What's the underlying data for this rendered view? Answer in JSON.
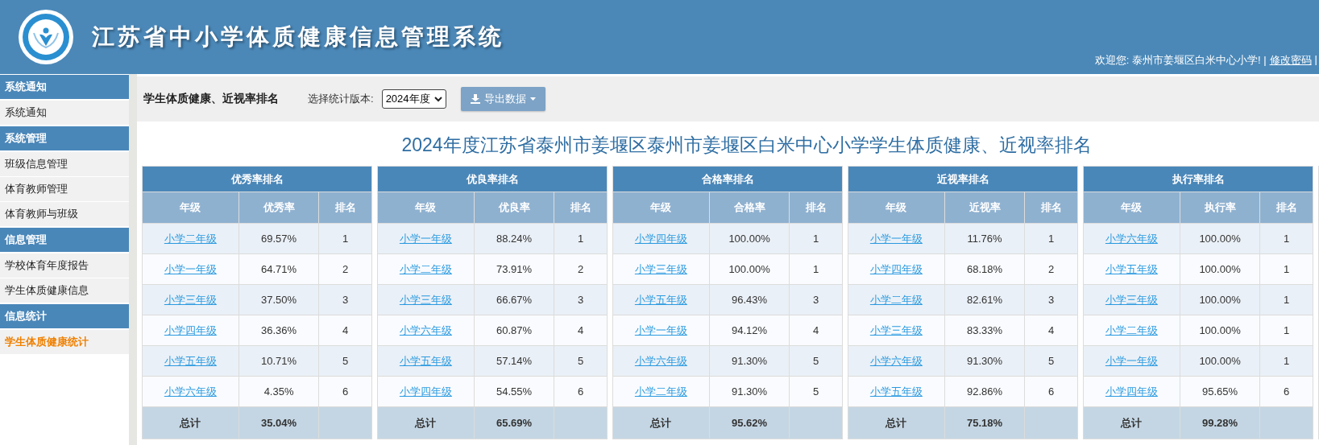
{
  "header": {
    "title": "江苏省中小学体质健康信息管理系统",
    "welcome": "欢迎您: 泰州市姜堰区白米中心小学! |",
    "links": [
      "修改密码"
    ],
    "trailing": "|"
  },
  "sidebar": {
    "sections": [
      {
        "title": "系统通知",
        "items": [
          {
            "label": "系统通知",
            "selected": false
          }
        ]
      },
      {
        "title": "系统管理",
        "items": [
          {
            "label": "班级信息管理",
            "selected": false
          },
          {
            "label": "体育教师管理",
            "selected": false
          },
          {
            "label": "体育教师与班级",
            "selected": false
          }
        ]
      },
      {
        "title": "信息管理",
        "items": [
          {
            "label": "学校体育年度报告",
            "selected": false
          },
          {
            "label": "学生体质健康信息",
            "selected": false
          }
        ]
      },
      {
        "title": "信息统计",
        "items": [
          {
            "label": "学生体质健康统计",
            "selected": true
          }
        ]
      }
    ]
  },
  "toolbar": {
    "title": "学生体质健康、近视率排名",
    "version_label": "选择统计版本:",
    "version_value": "2024年度",
    "export_button": "导出数据"
  },
  "report_title": "2024年度江苏省泰州市姜堰区泰州市姜堰区白米中心小学学生体质健康、近视率排名",
  "tables": [
    {
      "title": "优秀率排名",
      "columns": [
        "年级",
        "优秀率",
        "排名"
      ],
      "rows": [
        [
          "小学二年级",
          "69.57%",
          "1"
        ],
        [
          "小学一年级",
          "64.71%",
          "2"
        ],
        [
          "小学三年级",
          "37.50%",
          "3"
        ],
        [
          "小学四年级",
          "36.36%",
          "4"
        ],
        [
          "小学五年级",
          "10.71%",
          "5"
        ],
        [
          "小学六年级",
          "4.35%",
          "6"
        ]
      ],
      "total": [
        "总计",
        "35.04%"
      ]
    },
    {
      "title": "优良率排名",
      "columns": [
        "年级",
        "优良率",
        "排名"
      ],
      "rows": [
        [
          "小学一年级",
          "88.24%",
          "1"
        ],
        [
          "小学二年级",
          "73.91%",
          "2"
        ],
        [
          "小学三年级",
          "66.67%",
          "3"
        ],
        [
          "小学六年级",
          "60.87%",
          "4"
        ],
        [
          "小学五年级",
          "57.14%",
          "5"
        ],
        [
          "小学四年级",
          "54.55%",
          "6"
        ]
      ],
      "total": [
        "总计",
        "65.69%"
      ]
    },
    {
      "title": "合格率排名",
      "columns": [
        "年级",
        "合格率",
        "排名"
      ],
      "rows": [
        [
          "小学四年级",
          "100.00%",
          "1"
        ],
        [
          "小学三年级",
          "100.00%",
          "1"
        ],
        [
          "小学五年级",
          "96.43%",
          "3"
        ],
        [
          "小学一年级",
          "94.12%",
          "4"
        ],
        [
          "小学六年级",
          "91.30%",
          "5"
        ],
        [
          "小学二年级",
          "91.30%",
          "5"
        ]
      ],
      "total": [
        "总计",
        "95.62%"
      ]
    },
    {
      "title": "近视率排名",
      "columns": [
        "年级",
        "近视率",
        "排名"
      ],
      "rows": [
        [
          "小学一年级",
          "11.76%",
          "1"
        ],
        [
          "小学四年级",
          "68.18%",
          "2"
        ],
        [
          "小学二年级",
          "82.61%",
          "3"
        ],
        [
          "小学三年级",
          "83.33%",
          "4"
        ],
        [
          "小学六年级",
          "91.30%",
          "5"
        ],
        [
          "小学五年级",
          "92.86%",
          "6"
        ]
      ],
      "total": [
        "总计",
        "75.18%"
      ]
    },
    {
      "title": "执行率排名",
      "columns": [
        "年级",
        "执行率",
        "排名"
      ],
      "rows": [
        [
          "小学六年级",
          "100.00%",
          "1"
        ],
        [
          "小学五年级",
          "100.00%",
          "1"
        ],
        [
          "小学三年级",
          "100.00%",
          "1"
        ],
        [
          "小学二年级",
          "100.00%",
          "1"
        ],
        [
          "小学一年级",
          "100.00%",
          "1"
        ],
        [
          "小学四年级",
          "95.65%",
          "6"
        ]
      ],
      "total": [
        "总计",
        "99.28%"
      ]
    }
  ]
}
